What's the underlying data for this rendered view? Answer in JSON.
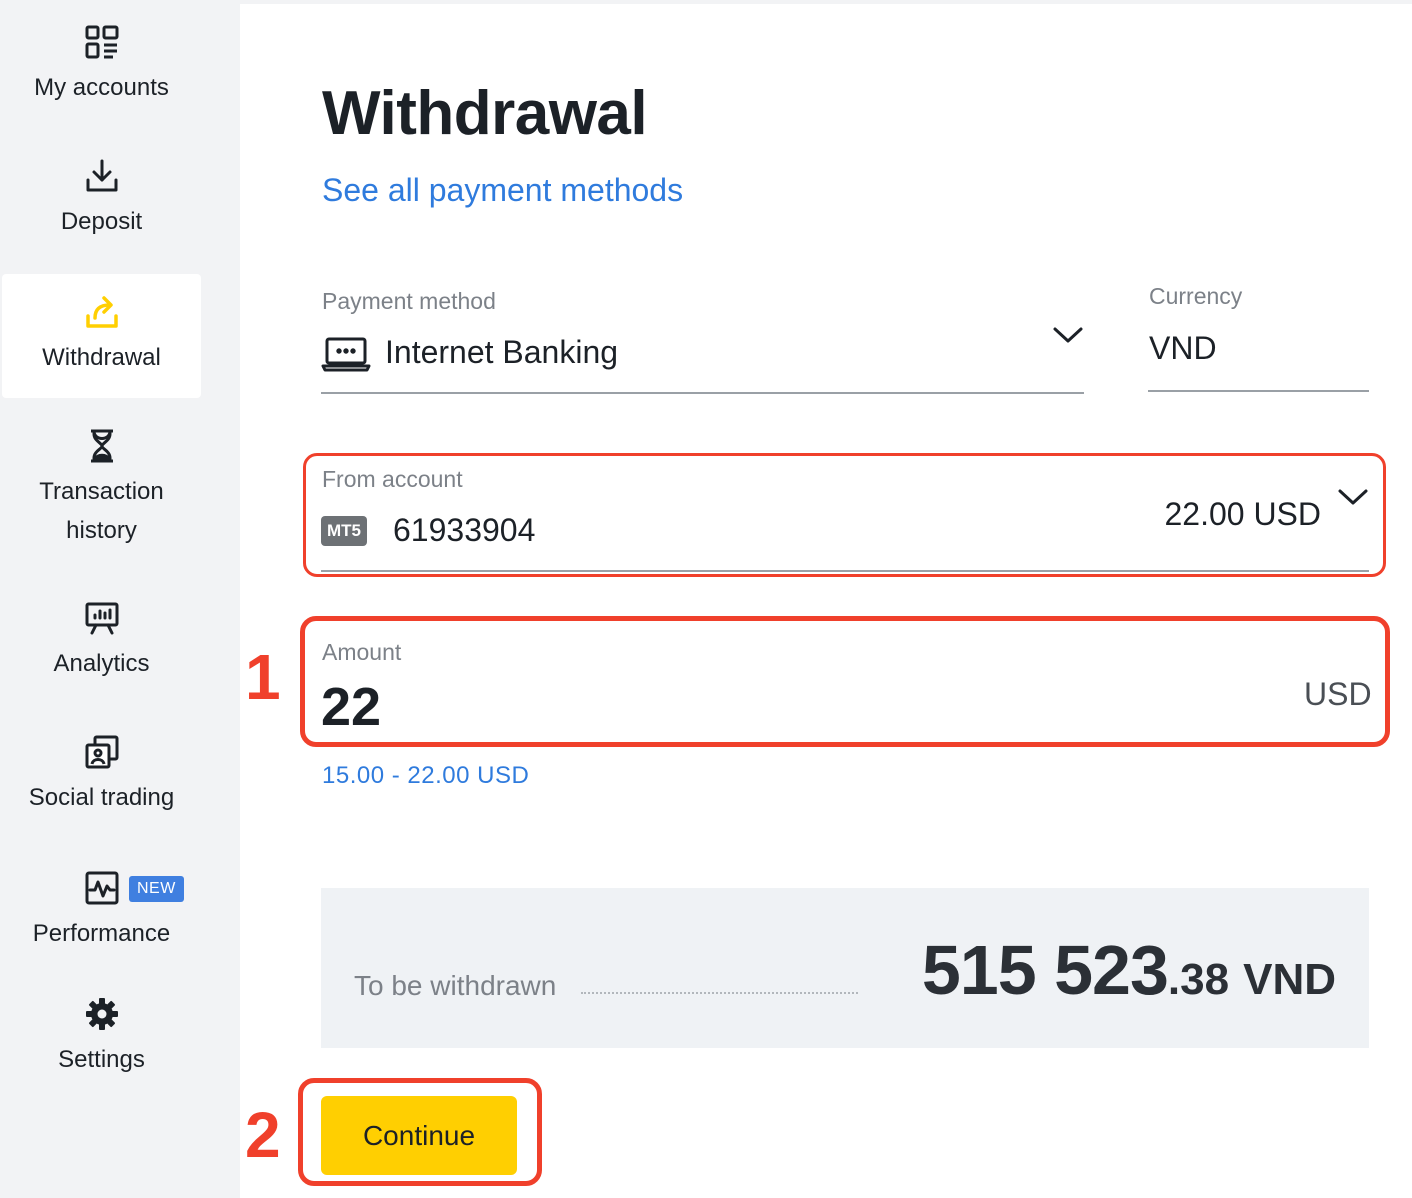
{
  "sidebar": {
    "items": [
      {
        "label": "My accounts",
        "icon": "accounts-grid-icon"
      },
      {
        "label": "Deposit",
        "icon": "download-icon"
      },
      {
        "label": "Withdrawal",
        "icon": "withdrawal-upload-icon",
        "active": true
      },
      {
        "label": "Transaction\nhistory",
        "icon": "hourglass-icon"
      },
      {
        "label": "Analytics",
        "icon": "presentation-chart-icon"
      },
      {
        "label": "Social trading",
        "icon": "social-trading-icon"
      },
      {
        "label": "Performance",
        "icon": "performance-chart-icon",
        "badge": "NEW"
      },
      {
        "label": "Settings",
        "icon": "gear-icon"
      }
    ]
  },
  "page": {
    "title": "Withdrawal",
    "methods_link": "See all payment methods"
  },
  "form": {
    "payment_method_label": "Payment method",
    "payment_method_value": "Internet Banking",
    "currency_label": "Currency",
    "currency_value": "VND",
    "from_account_label": "From account",
    "account_platform": "MT5",
    "account_number": "61933904",
    "account_balance": "22.00 USD",
    "amount_label": "Amount",
    "amount_value": "22",
    "amount_unit": "USD",
    "amount_range": "15.00 - 22.00 USD"
  },
  "summary": {
    "label": "To be withdrawn",
    "amount_integer": "515 523",
    "amount_decimal": ".38",
    "currency": "VND"
  },
  "actions": {
    "continue_label": "Continue"
  },
  "annotations": {
    "step_1": "1",
    "step_2": "2"
  },
  "colors": {
    "accent_yellow": "#ffcf01",
    "link_blue": "#2f7bdd",
    "highlight_red": "#f0402b",
    "badge_blue": "#3f7fe0"
  }
}
